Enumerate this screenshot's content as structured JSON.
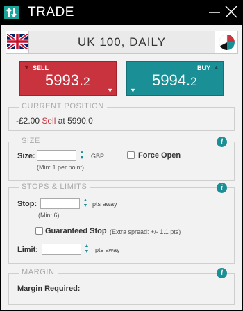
{
  "window": {
    "title": "TRADE",
    "minimize_icon": "minimize-icon",
    "close_icon": "close-icon"
  },
  "header": {
    "instrument": "UK 100, DAILY",
    "flag_icon": "uk-flag-icon",
    "chart_icon": "pie-chart-icon"
  },
  "sell": {
    "label": "SELL",
    "price_main": "5993.",
    "price_dec": "2",
    "color": "#c9333d"
  },
  "buy": {
    "label": "BUY",
    "price_main": "5994.",
    "price_dec": "2",
    "color": "#1a8f96"
  },
  "current_position": {
    "title": "CURRENT POSITION",
    "amount": "-£2.00",
    "direction": "Sell",
    "at_text": "at 5990.0"
  },
  "size": {
    "title": "SIZE",
    "label": "Size:",
    "value": "",
    "unit": "GBP",
    "min_note": "(Min: 1 per point)",
    "force_open_label": "Force Open"
  },
  "stops": {
    "title": "STOPS & LIMITS",
    "stop_label": "Stop:",
    "stop_value": "",
    "stop_unit": "pts away",
    "stop_min": "(Min: 6)",
    "guaranteed_label": "Guaranteed Stop",
    "guaranteed_note": "(Extra spread: +/- 1.1 pts)",
    "limit_label": "Limit:",
    "limit_value": "",
    "limit_unit": "pts away"
  },
  "margin": {
    "title": "MARGIN",
    "required_label": "Margin Required:"
  }
}
